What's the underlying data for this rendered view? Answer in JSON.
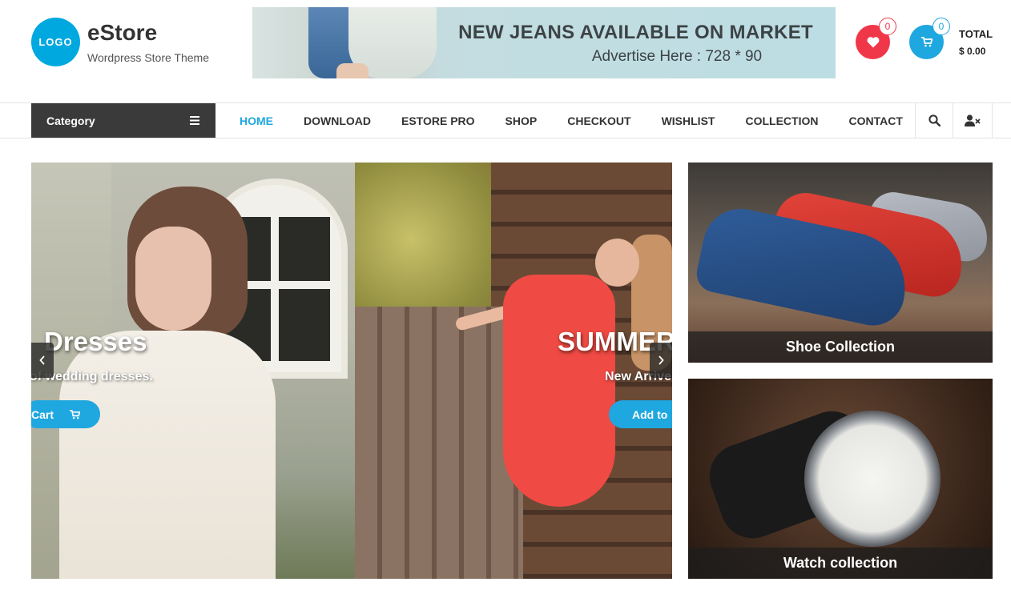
{
  "header": {
    "logo_text": "LOGO",
    "site_title": "eStore",
    "site_tagline": "Wordpress Store Theme",
    "banner_title": "NEW JEANS AVAILABLE ON MARKET",
    "banner_subtitle": "Advertise Here : 728 * 90",
    "wishlist_count": "0",
    "cart_count": "0",
    "total_label": "TOTAL",
    "total_value": "$ 0.00"
  },
  "nav": {
    "category_label": "Category",
    "items": [
      "HOME",
      "DOWNLOAD",
      "ESTORE PRO",
      "SHOP",
      "CHECKOUT",
      "WISHLIST",
      "COLLECTION",
      "CONTACT"
    ],
    "active_index": 0
  },
  "slider": {
    "left_slide": {
      "title": "Dresses",
      "subtitle": "of wedding dresses.",
      "button": "Cart"
    },
    "right_slide": {
      "title": "SUMMER",
      "subtitle": "New Arrive",
      "button": "Add to"
    }
  },
  "promos": {
    "shoe": {
      "caption": "Shoe Collection"
    },
    "watch": {
      "caption": "Watch collection"
    }
  },
  "colors": {
    "accent": "#1fa7df",
    "wishlist": "#f0374a",
    "category_bg": "#3a3a3a"
  },
  "icons": [
    "heart-icon",
    "cart-icon",
    "menu-icon",
    "search-icon",
    "user-x-icon",
    "chevron-left-icon",
    "chevron-right-icon"
  ]
}
